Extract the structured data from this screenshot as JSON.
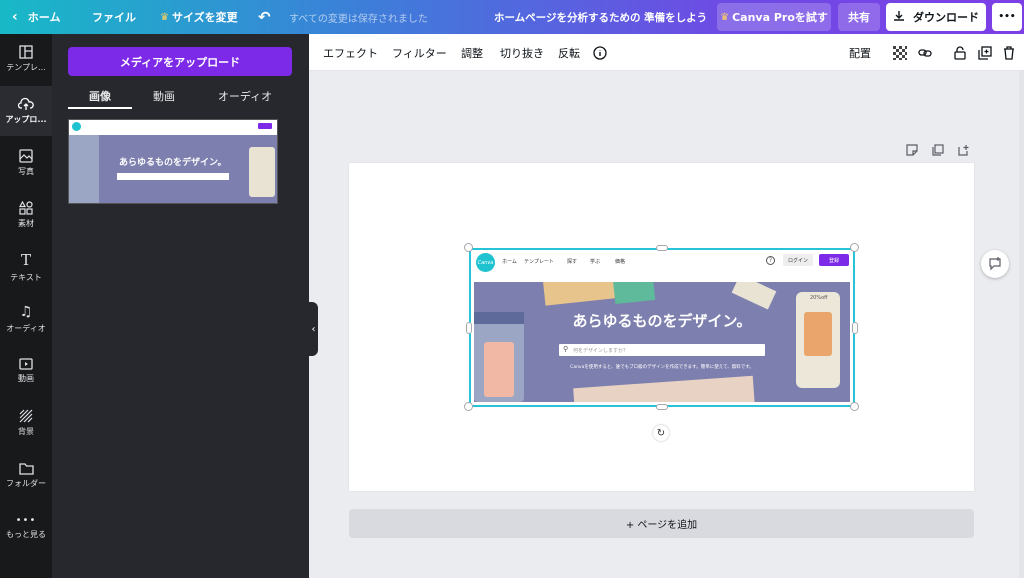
{
  "topbar": {
    "home": "ホーム",
    "file": "ファイル",
    "resize": "サイズを変更",
    "saved_status": "すべての変更は保存されました",
    "doc_title": "ホームページを分析するための 準備をしよう",
    "canva_pro": "Canva Proを試す",
    "share": "共有",
    "download": "ダウンロード",
    "more": "•••"
  },
  "leftnav": {
    "items": [
      {
        "label": "テンプレ..."
      },
      {
        "label": "アップロ..."
      },
      {
        "label": "写真"
      },
      {
        "label": "素材"
      },
      {
        "label": "テキスト"
      },
      {
        "label": "オーディオ"
      },
      {
        "label": "動画"
      },
      {
        "label": "背景"
      },
      {
        "label": "フォルダー"
      },
      {
        "label": "もっと見る"
      }
    ]
  },
  "panel": {
    "upload_button": "メディアをアップロード",
    "tabs": [
      "画像",
      "動画",
      "オーディオ"
    ],
    "active_tab": "画像"
  },
  "toolbar": {
    "effects": "エフェクト",
    "filter": "フィルター",
    "adjust": "調整",
    "crop": "切り抜き",
    "flip": "反転",
    "position": "配置"
  },
  "canvas_image": {
    "logo": "Canva",
    "nav": [
      "ホーム",
      "テンプレート",
      "探す",
      "学ぶ",
      "価格"
    ],
    "login": "ログイン",
    "signup": "登録",
    "headline": "あらゆるものをデザイン。",
    "search_placeholder": "何をデザインしますか？",
    "subtext": "Canvaを使用すると、誰でもプロ級のデザインを作成できます。簡単に使えて、無料です。",
    "discount": "20%off"
  },
  "add_page": "+ ページを追加",
  "colors": {
    "brand_purple": "#7d2ae8",
    "selection": "#27c3d6",
    "hero_bg": "#7d7fae"
  }
}
